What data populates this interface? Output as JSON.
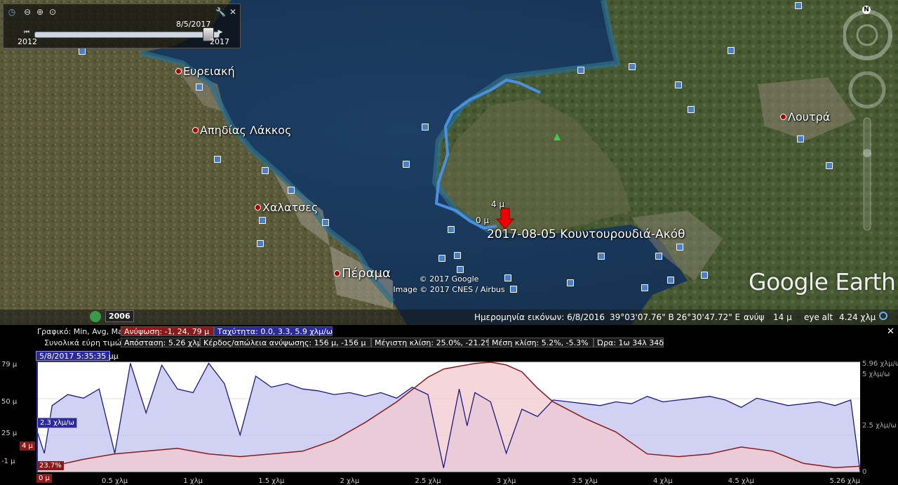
{
  "map": {
    "places": [
      {
        "name": "Ευρειακή"
      },
      {
        "name": "Απηδίας Λάκκος"
      },
      {
        "name": "Χαλατσες"
      },
      {
        "name": "Πέραμα"
      },
      {
        "name": "Λουτρά"
      }
    ],
    "track_label": "2017-08-05 Κουντουρουδιά-Ακόθ",
    "marker_4m": "4 μ",
    "marker_0m": "0 μ",
    "copyright_1": "© 2017 Google",
    "copyright_2": "Image © 2017 CNES / Airbus",
    "logo": "Google Earth",
    "historical_year": "2006"
  },
  "time_slider": {
    "current": "8/5/2017",
    "start": "2012",
    "end": "2017",
    "thumb_fraction": 0.93
  },
  "status": {
    "imagery_date": "Ημερομηνία εικόνων: 6/8/2016",
    "lat": "39°03'07.76\" Β",
    "lon": "26°30'47.72\" Ε",
    "elev_label": "ανύψ",
    "elev_value": "14 μ",
    "eye_label": "eye alt",
    "eye_value": "4.24 χλμ"
  },
  "profile": {
    "graph_label": "Γραφικό: Min, Avg, Max:",
    "elevation_stats": "Ανύψωση: -1, 24, 79 μ",
    "speed_stats": "Ταχύτητα: 0.0, 3.3, 5.9 χλμ/ω",
    "totals_label": "Συνολικά εύρη τιμών:",
    "distance": "Απόσταση: 5.26 χλμ",
    "gain_loss": "Κέρδος/απώλεια ανύψωσης: 156 μ, -156 μ",
    "max_slope": "Μέγιστη κλίση: 25.0%, -21.2%",
    "avg_slope": "Μέση κλίση: 5.2%, -5.3%",
    "time": "Ώρα: 1ω 34λ 34δ",
    "timestamp": "5/8/2017 5:35:35 μμ",
    "speed_tag": "2.3 χλμ/ω",
    "elev_tag": "4 μ",
    "slope_tag": "23.7%",
    "x_start": "0 μ",
    "colors": {
      "elevation": "#8b1a1a",
      "speed": "#1a1a80",
      "elev_fill": "#f2c9cf",
      "speed_fill": "#c9c9f2"
    }
  },
  "chart_data": {
    "type": "area",
    "xlabel": "",
    "ylabel": "",
    "x_tick_labels": [
      "0 μ",
      "0.5 χλμ",
      "1 χλμ",
      "1.5 χλμ",
      "2 χλμ",
      "2.5 χλμ",
      "3 χλμ",
      "3.5 χλμ",
      "4 χλμ",
      "4.5 χλμ",
      "5.26 χλμ"
    ],
    "y_left_ticks": [
      "79 μ",
      "50 μ",
      "25 μ",
      "-1 μ"
    ],
    "y_right_ticks": [
      "5.96 χλμ/ω",
      "5 χλμ/ω",
      "2.5 χλμ/ω",
      "0"
    ],
    "xlim": [
      0,
      5.26
    ],
    "series": [
      {
        "name": "Ανύψωση",
        "unit": "μ",
        "ylim": [
          -1,
          79
        ],
        "x": [
          0,
          0.1,
          0.3,
          0.5,
          0.7,
          0.9,
          1.1,
          1.3,
          1.5,
          1.7,
          1.9,
          2.1,
          2.3,
          2.5,
          2.6,
          2.7,
          2.8,
          2.9,
          3.0,
          3.1,
          3.2,
          3.3,
          3.5,
          3.7,
          3.9,
          4.1,
          4.3,
          4.5,
          4.7,
          4.9,
          5.1,
          5.26
        ],
        "values": [
          4,
          3,
          8,
          12,
          14,
          16,
          12,
          10,
          12,
          14,
          22,
          35,
          50,
          68,
          74,
          76,
          78,
          79,
          77,
          72,
          60,
          50,
          38,
          28,
          12,
          10,
          12,
          17,
          14,
          5,
          2,
          3
        ]
      },
      {
        "name": "Ταχύτητα",
        "unit": "χλμ/ω",
        "ylim": [
          0,
          5.96
        ],
        "x": [
          0,
          0.05,
          0.1,
          0.2,
          0.3,
          0.4,
          0.5,
          0.6,
          0.7,
          0.8,
          0.9,
          1.0,
          1.1,
          1.2,
          1.3,
          1.4,
          1.5,
          1.6,
          1.7,
          1.8,
          1.9,
          2.0,
          2.1,
          2.2,
          2.3,
          2.4,
          2.5,
          2.6,
          2.7,
          2.75,
          2.8,
          2.9,
          3.0,
          3.1,
          3.2,
          3.3,
          3.4,
          3.5,
          3.6,
          3.7,
          3.8,
          3.9,
          4.0,
          4.1,
          4.2,
          4.3,
          4.4,
          4.5,
          4.6,
          4.7,
          4.8,
          4.9,
          5.0,
          5.1,
          5.2,
          5.26
        ],
        "values": [
          2.3,
          1.0,
          3.6,
          4.2,
          4.0,
          4.5,
          1.0,
          5.9,
          3.2,
          5.8,
          4.5,
          4.3,
          5.9,
          4.8,
          2.0,
          5.2,
          4.6,
          4.8,
          4.5,
          4.4,
          4.2,
          4.3,
          4.1,
          4.3,
          4.0,
          4.6,
          4.2,
          0.2,
          4.5,
          2.5,
          4.3,
          3.8,
          1.0,
          3.4,
          3.0,
          3.9,
          3.8,
          3.7,
          3.6,
          3.8,
          3.7,
          4.1,
          3.8,
          3.9,
          4.0,
          4.1,
          3.9,
          3.5,
          4.0,
          3.8,
          3.6,
          3.7,
          3.8,
          3.6,
          3.9,
          0.0
        ]
      }
    ]
  }
}
